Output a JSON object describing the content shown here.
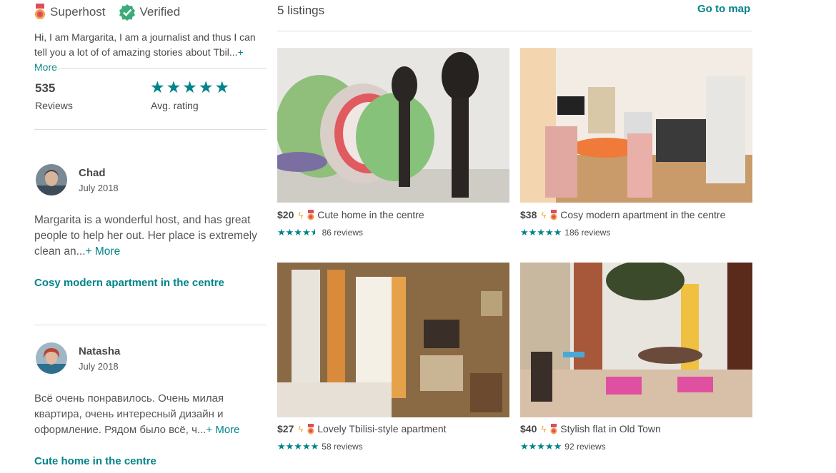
{
  "host": {
    "badges": [
      {
        "icon": "superhost-medal-icon",
        "label": "Superhost"
      },
      {
        "icon": "verified-check-icon",
        "label": "Verified"
      }
    ],
    "bio": "Hi, I am Margarita, I am a journalist and thus I can tell you a lot of of amazing stories about Tbil...",
    "bio_more": "+ More",
    "reviews_count": "535",
    "reviews_label": "Reviews",
    "avg_rating_stars": 5,
    "avg_rating_label": "Avg. rating"
  },
  "reviews": [
    {
      "name": "Chad",
      "date": "July 2018",
      "text": "Margarita is a wonderful host, and has great people to help her out. Her place is extremely clean an...",
      "more": "+ More",
      "listing": "Cosy modern apartment in the centre"
    },
    {
      "name": "Natasha",
      "date": "July 2018",
      "text": "Всё очень понравилось. Очень милая квартира, очень интересный дизайн и оформление. Рядом было всё, ч...",
      "more": "+ More",
      "listing": "Cute home in the centre"
    }
  ],
  "listings_header": {
    "count": "5 listings",
    "map_link": "Go to map"
  },
  "listings": [
    {
      "price": "$20",
      "title": "Cute home in the centre",
      "rating": 4.5,
      "reviews": "86 reviews"
    },
    {
      "price": "$38",
      "title": "Cosy modern apartment in the centre",
      "rating": 5,
      "reviews": "186 reviews"
    },
    {
      "price": "$27",
      "title": "Lovely Tbilisi-style apartment",
      "rating": 5,
      "reviews": "58 reviews"
    },
    {
      "price": "$40",
      "title": "Stylish flat in Old Town",
      "rating": 5,
      "reviews": "92 reviews"
    }
  ],
  "colors": {
    "accent": "#008489",
    "instant_book": "#f5a623",
    "text": "#484848",
    "divider": "#dcdcdc"
  }
}
